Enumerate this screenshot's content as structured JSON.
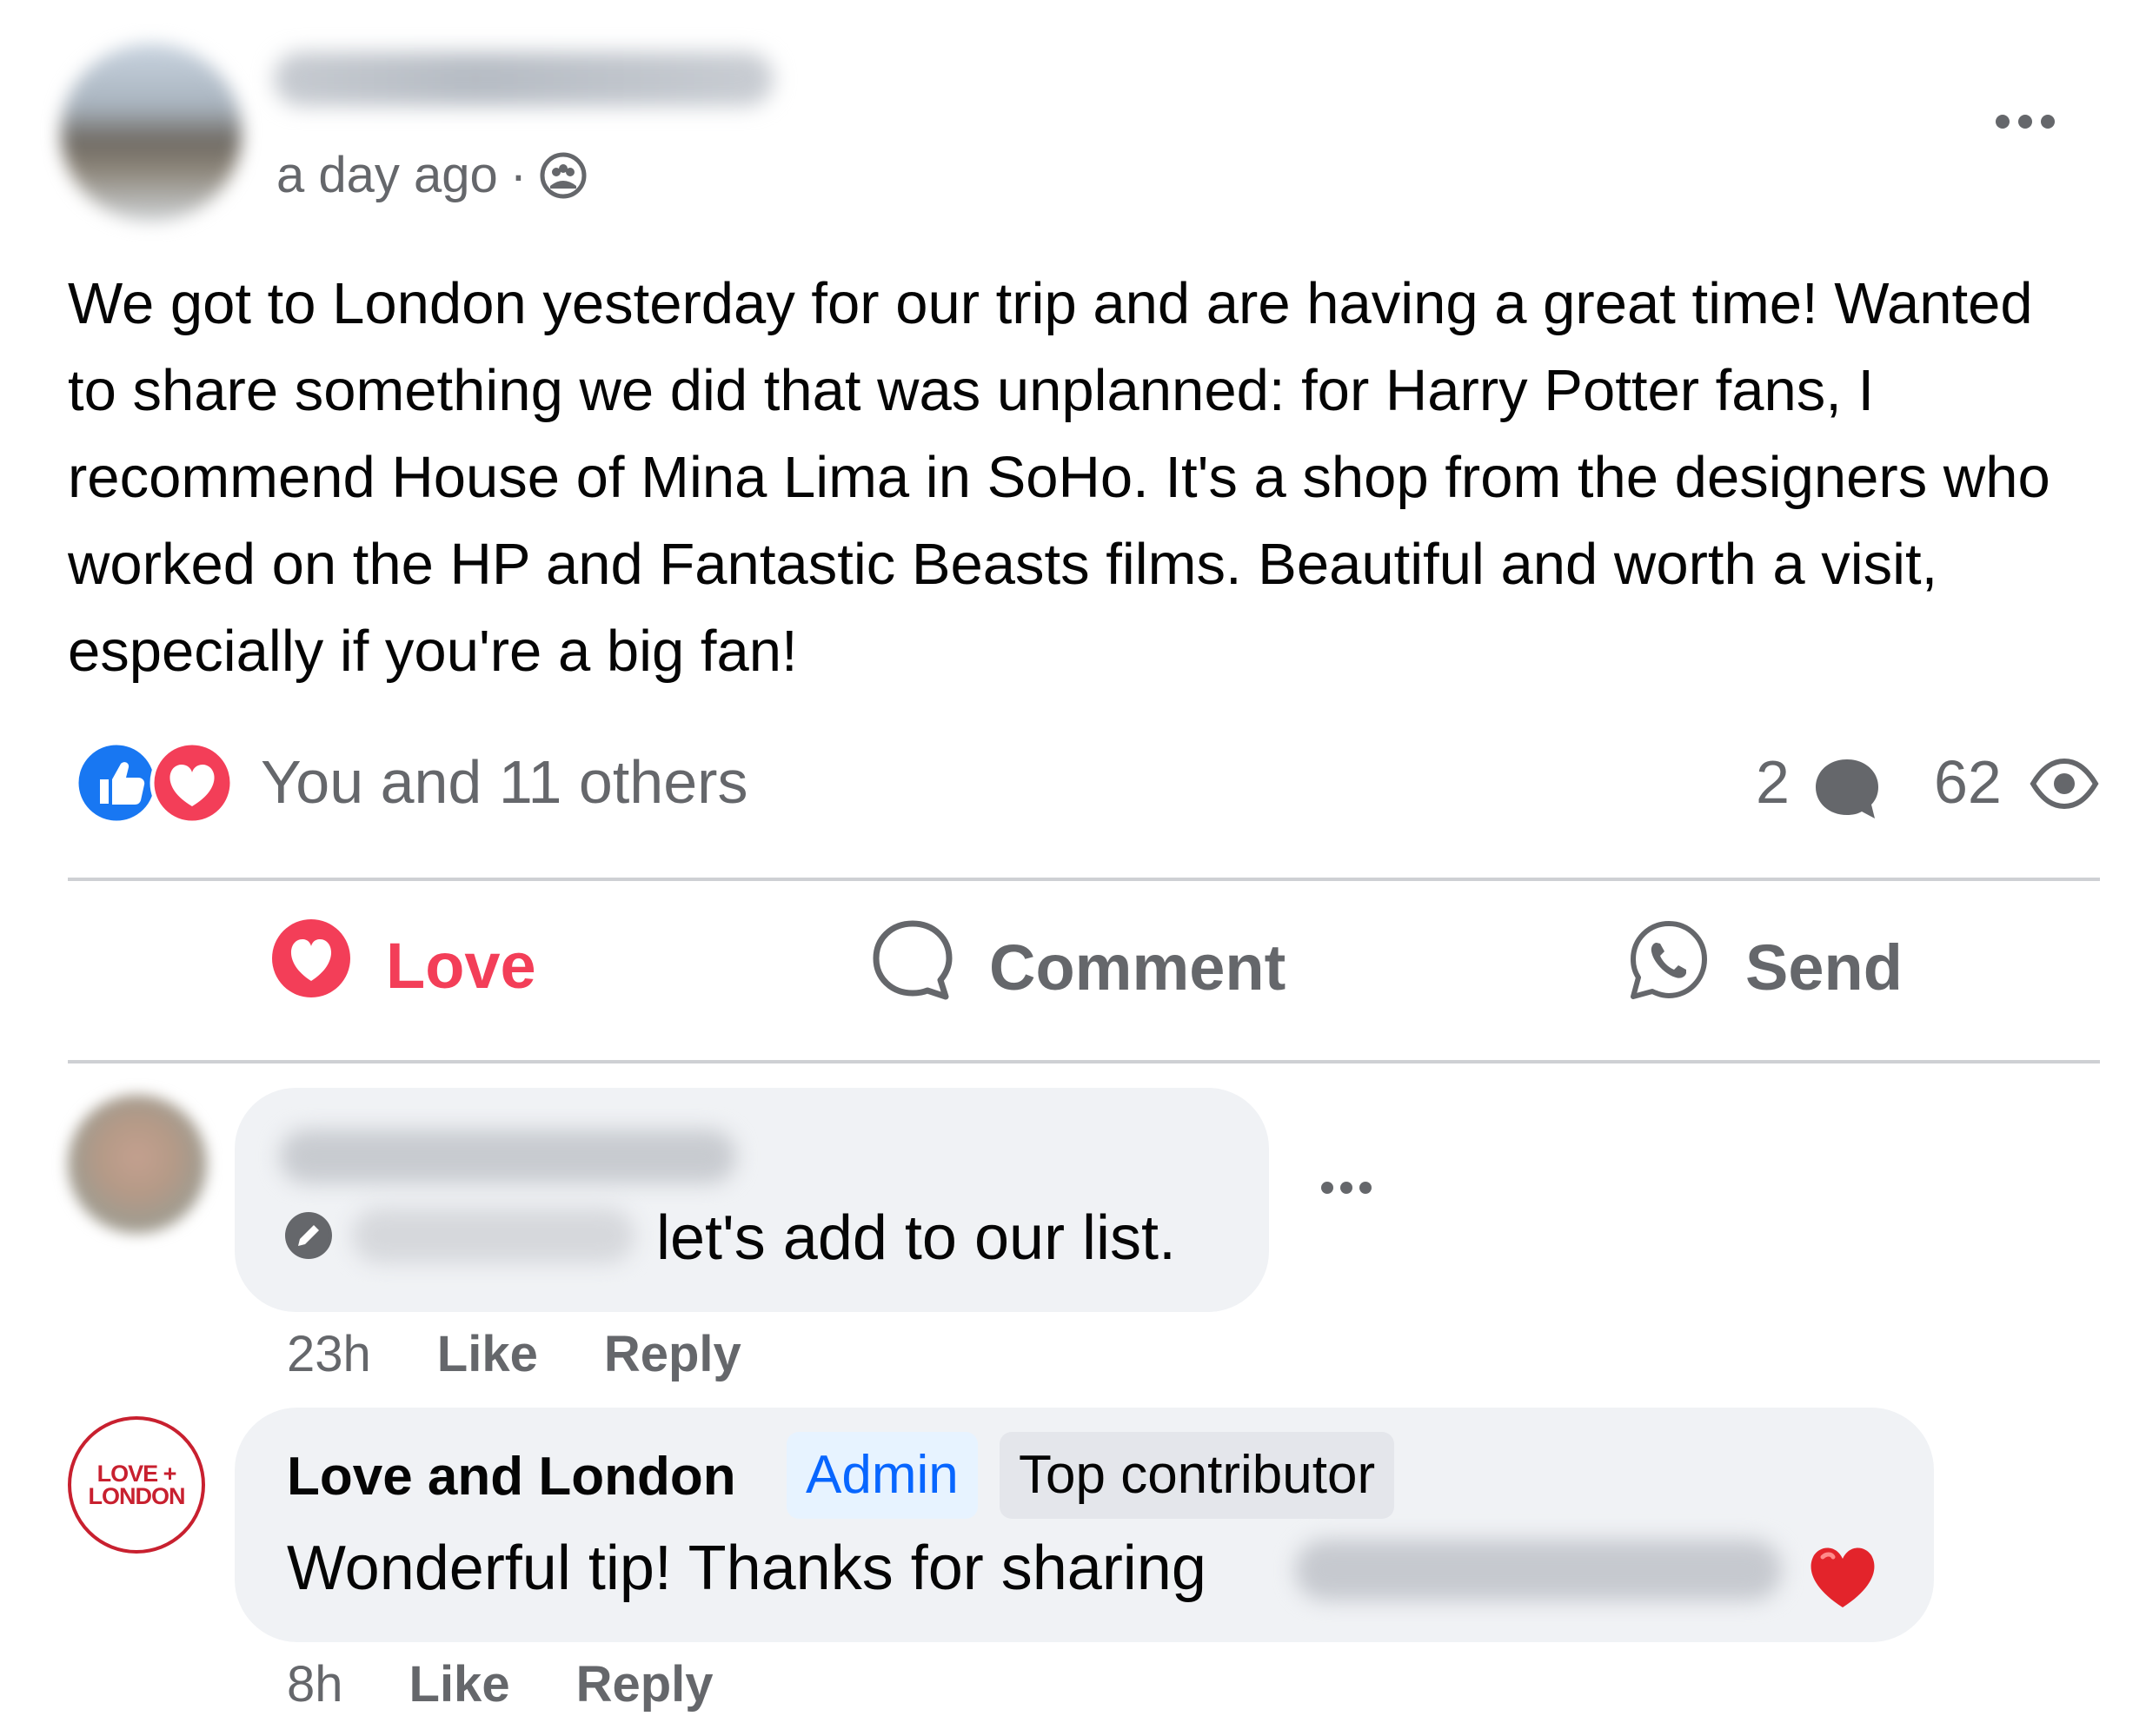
{
  "post": {
    "author_name": "",
    "time": "a day ago",
    "separator": "·",
    "audience_icon": "group-icon",
    "text": "We got to London yesterday for our trip and are having a great time! Wanted to share something we did that was unplanned: for Harry Potter fans, I recommend House of Mina Lima in SoHo. It's a shop from the designers who worked on the HP and Fantastic Beasts films. Beautiful and worth a visit, especially if you're a big fan!",
    "reactions_text": "You and 11 others",
    "comments_count": "2",
    "views_count": "62"
  },
  "actions": {
    "love_label": "Love",
    "comment_label": "Comment",
    "send_label": "Send"
  },
  "comments": [
    {
      "author_name": "",
      "text": "let's add to our list.",
      "time": "23h",
      "like_label": "Like",
      "reply_label": "Reply"
    },
    {
      "author_name": "Love and London",
      "avatar_logo": [
        "LOVE +",
        "LONDON"
      ],
      "badge_admin": "Admin",
      "badge_top": "Top contributor",
      "text": "Wonderful tip! Thanks for sharing",
      "time": "8h",
      "like_label": "Like",
      "reply_label": "Reply"
    }
  ],
  "colors": {
    "love": "#f33e58",
    "like_blue": "#0866ff",
    "muted": "#65676b",
    "bubble": "#f0f2f5"
  }
}
